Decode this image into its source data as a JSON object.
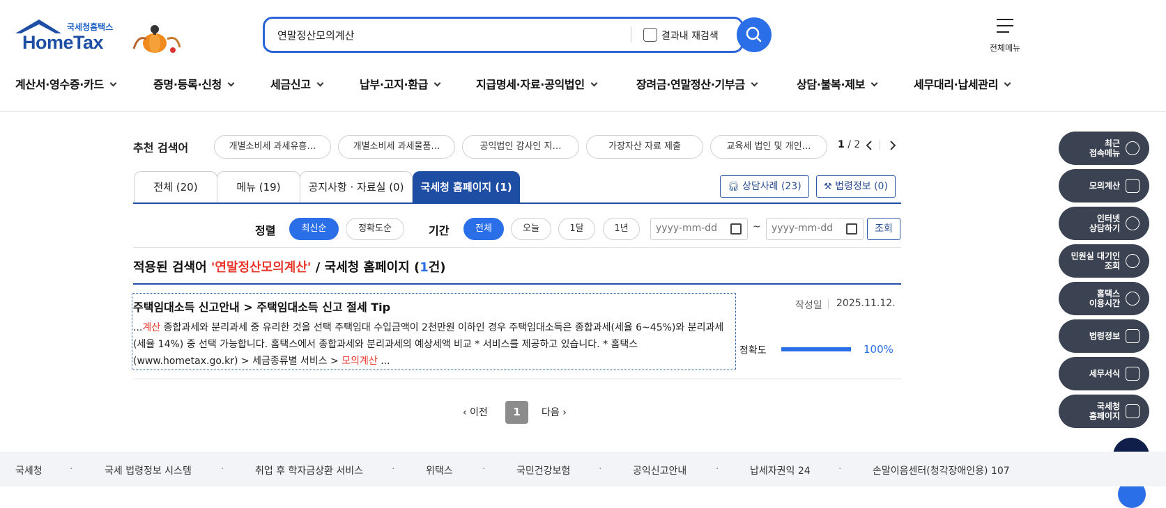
{
  "header": {
    "brand_small": "국세청홈택스",
    "brand": "HomeTax",
    "search_value": "연말정산모의계산",
    "search_within_label": "결과내 재검색",
    "menu_all_label": "전체메뉴"
  },
  "gnb": [
    "계산서·영수증·카드",
    "증명·등록·신청",
    "세금신고",
    "납부·고지·환급",
    "지급명세·자료·공익법인",
    "장려금·연말정산·기부금",
    "상담·불복·제보",
    "세무대리·납세관리"
  ],
  "recommended": {
    "title": "추천 검색어",
    "chips": [
      "개별소비세 과세유흥…",
      "개별소비세 과세물품…",
      "공익법인 감사인 지…",
      "가장자산 자료 제출",
      "교육세 법인 및 개인…"
    ],
    "page_current": "1",
    "page_total": "/ 2"
  },
  "tabs": [
    "전체 (20)",
    "메뉴 (19)",
    "공지사항 · 자료실 (0)",
    "국세청 홈페이지 (1)"
  ],
  "tab_buttons": {
    "consult": "상담사례 (23)",
    "law": "법령정보 (0)"
  },
  "filters": {
    "sort_label": "정렬",
    "sort_options": [
      "최신순",
      "정확도순"
    ],
    "period_label": "기간",
    "period_options": [
      "전체",
      "오늘",
      "1달",
      "1년"
    ],
    "date_placeholder": "yyyy-mm-dd",
    "tilde": "~",
    "search_button": "조회"
  },
  "applied": {
    "prefix": "적용된 검색어 ",
    "keyword": "'연말정산모의계산'",
    "middle": " / 국세청 홈페이지 (",
    "count": "1",
    "suffix": "건)"
  },
  "result": {
    "title": "주택임대소득 신고안내 > 주택임대소득 신고 절세 Tip",
    "body_1": "...",
    "body_hl_1": "계산",
    "body_2": " 종합과세와 분리과세 중 유리한 것을 선택 주택임대 수입금액이 2천만원 이하인 경우 주택임대소득은 종합과세(세율 6~45%)와 분리과세(세율 14%) 중 선택 가능합니다. 홈택스에서 종합과세와 분리과세의 예상세액 비교 * 서비스를 제공하고 있습니다. * 홈택스(www.hometax.go.kr) > 세금종류별 서비스 > ",
    "body_hl_2": "모의계산",
    "body_3": " ...",
    "date_label": "작성일",
    "date_value": "2025.11.12.",
    "accuracy_label": "정확도",
    "accuracy_value": "100%",
    "accuracy_fraction": 1.0
  },
  "pagination": {
    "prev": "‹ 이전",
    "current": "1",
    "next": "다음 ›"
  },
  "quick_menu": [
    {
      "label": "최근\n접속메뉴",
      "icon": "clock-icon"
    },
    {
      "label": "모의계산",
      "icon": "calculator-icon"
    },
    {
      "label": "인터넷\n상담하기",
      "icon": "headset-icon"
    },
    {
      "label": "민원실 대기인\n조회",
      "icon": "person-search-icon"
    },
    {
      "label": "홈택스\n이용시간",
      "icon": "alarm-icon"
    },
    {
      "label": "법령정보",
      "icon": "gavel-icon"
    },
    {
      "label": "세무서식",
      "icon": "document-edit-icon"
    },
    {
      "label": "국세청\n홈페이지",
      "icon": "building-icon"
    }
  ],
  "footer": [
    "국세청",
    "국세 법령정보 시스템",
    "취업 후 학자금상환 서비스",
    "위택스",
    "국민건강보험",
    "공익신고안내",
    "납세자권익 24",
    "손말이음센터(청각장애인용) 107"
  ],
  "footer_separator": "·",
  "colors": {
    "primary": "#1e4ea3",
    "accent": "#2b6fe8",
    "highlight": "#e8362d",
    "quick_menu_bg": "#3b4252"
  }
}
